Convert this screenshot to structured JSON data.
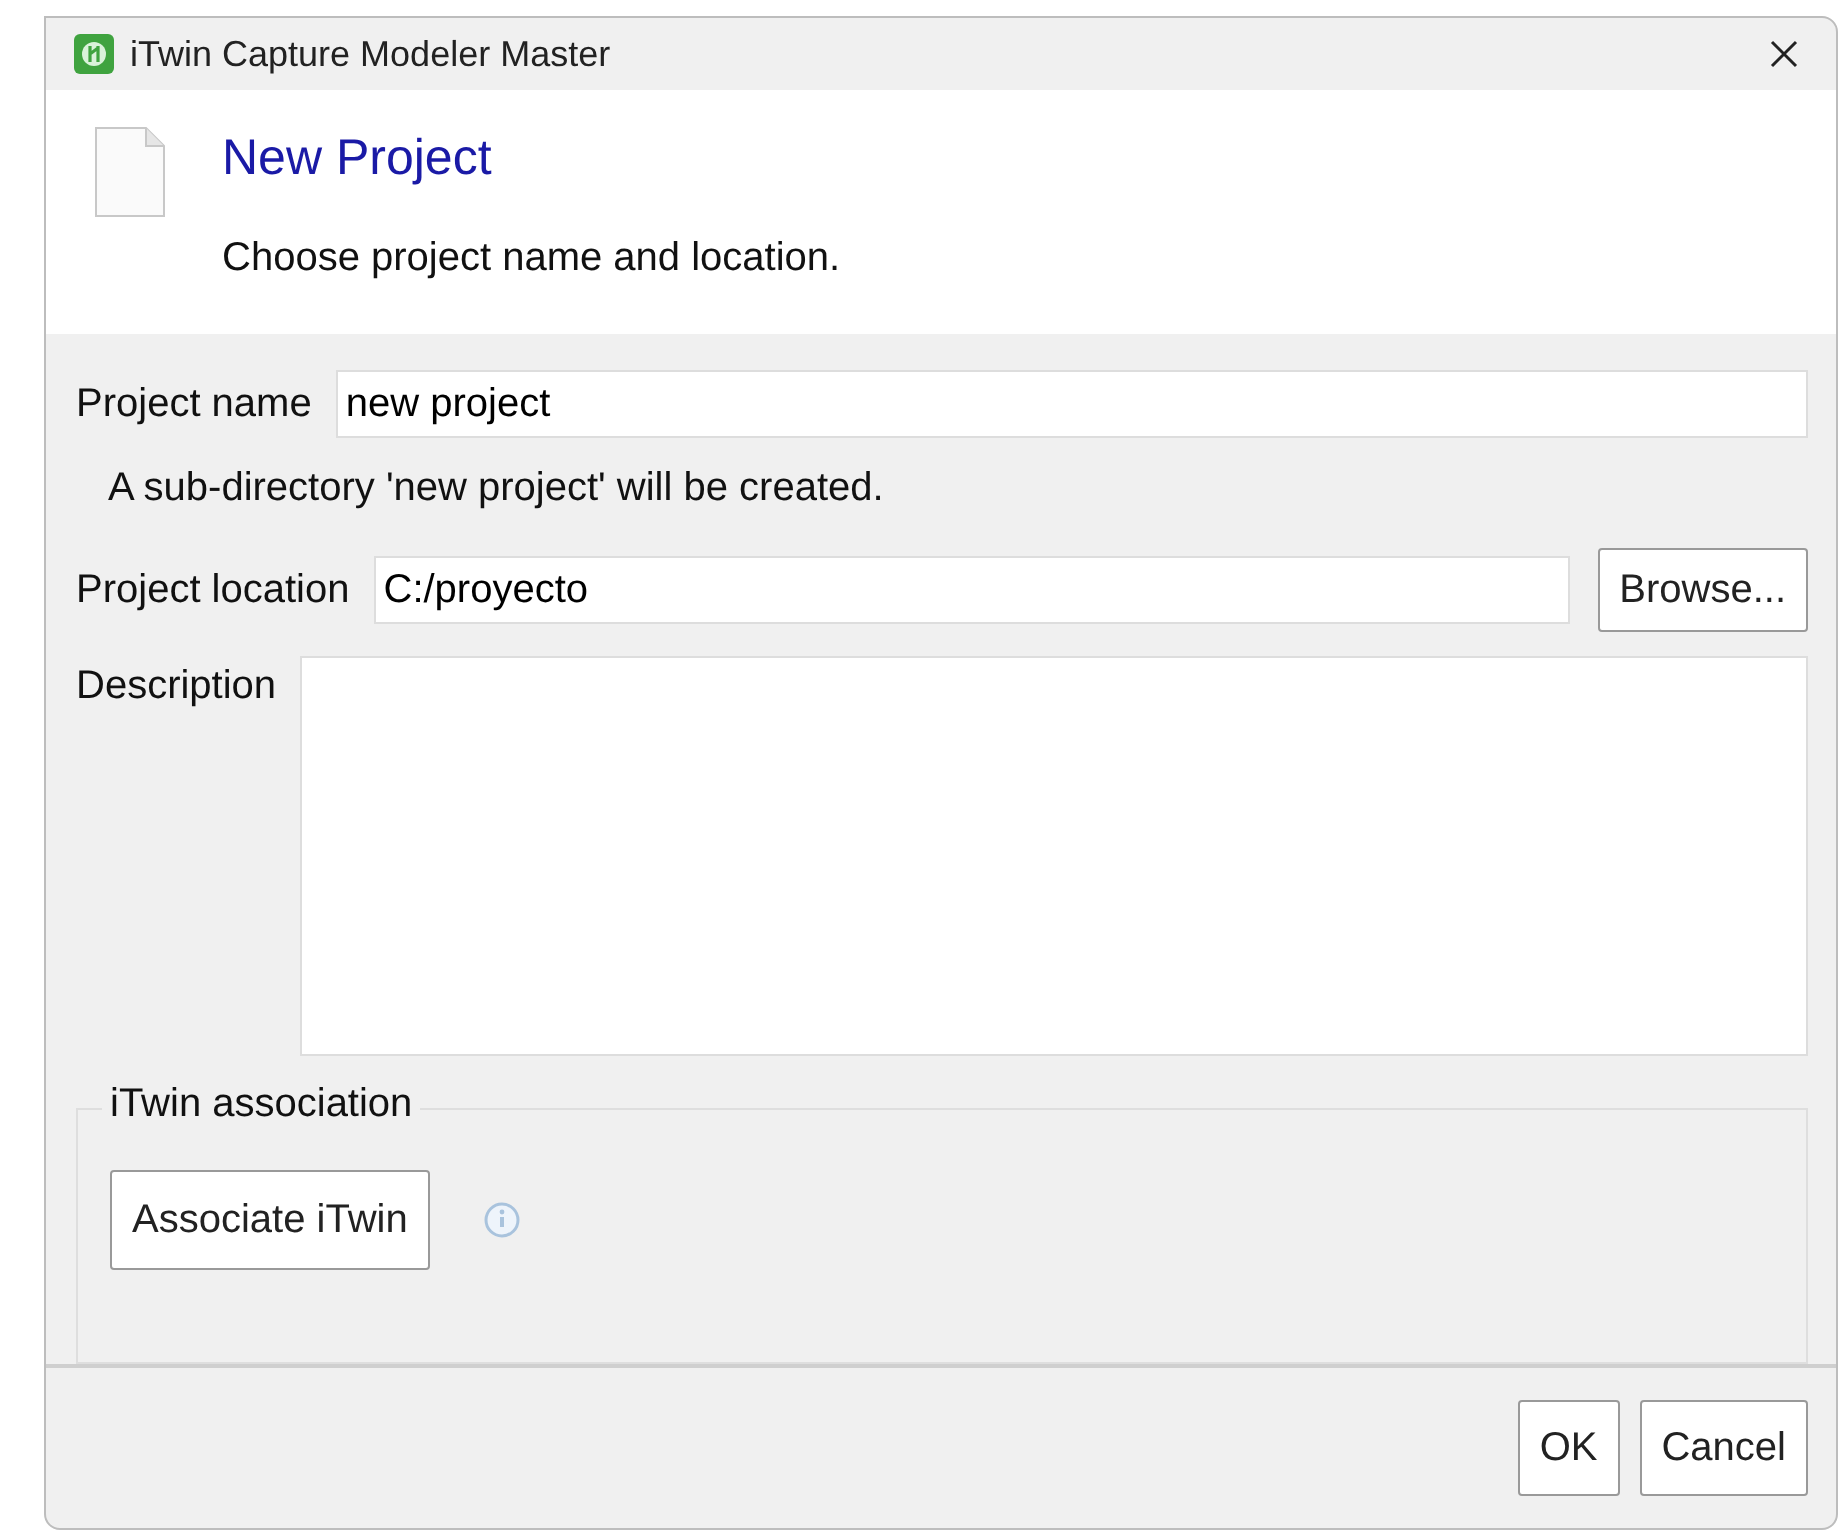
{
  "window": {
    "title": "iTwin Capture Modeler Master"
  },
  "header": {
    "title": "New Project",
    "subtitle": "Choose project name and location."
  },
  "project_name": {
    "label": "Project name",
    "value": "new project"
  },
  "note": "A sub-directory 'new project' will be created.",
  "project_location": {
    "label": "Project location",
    "value": "C:/proyecto",
    "button": "Browse..."
  },
  "description": {
    "label": "Description"
  },
  "itwin_association": {
    "title": "iTwin association",
    "button": "Associate iTwin"
  },
  "buttons": [
    "OK",
    "Cancel"
  ]
}
